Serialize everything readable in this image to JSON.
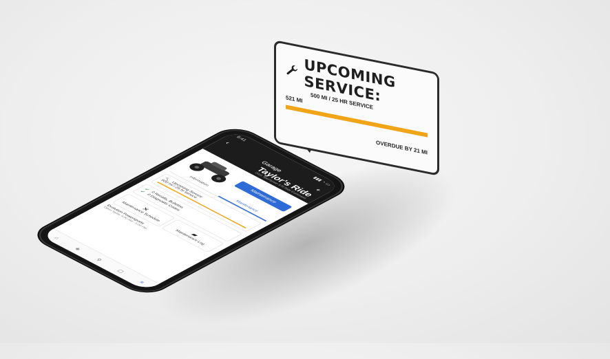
{
  "bubble": {
    "title": "UPCOMING SERVICE:",
    "service": "500 MI / 25 HR SERVICE",
    "current_mi": "521 MI",
    "overdue": "OVERDUE BY 21 MI",
    "progress_fraction": 1.0,
    "accent_color": "#f1a417",
    "icon": "wrench-icon"
  },
  "phone": {
    "status": {
      "time": "9:41",
      "signal": "▮▮▮ ◔ ▭"
    },
    "nav": {
      "back": "‹",
      "title": "Garage",
      "add": "+"
    },
    "ride": {
      "title": "Taylor's Ride",
      "subtitle": "2021 Sportsman 570 Ride Command"
    },
    "maintenance_button": "Maintenance",
    "tabs": [
      "Information",
      "Maintenance"
    ],
    "upcoming": {
      "title": "Upcoming Service",
      "detail": "500 mi / 25 hr service"
    },
    "recalls": "0 Recalls, Bulletins",
    "codes": "0 Diagnostic Codes",
    "tiles": [
      {
        "icon": "wrench-cross-icon",
        "label": "Maintenance Schedule"
      },
      {
        "icon": "book-icon",
        "label": "Maintenance Log"
      }
    ],
    "dealer": {
      "name": "Evolution Powersports",
      "hours": "Open Today 9:00 AM - 5:00 PM"
    },
    "tabbar": [
      "⌂",
      "◈",
      "⚲",
      "▢",
      "≡"
    ]
  }
}
